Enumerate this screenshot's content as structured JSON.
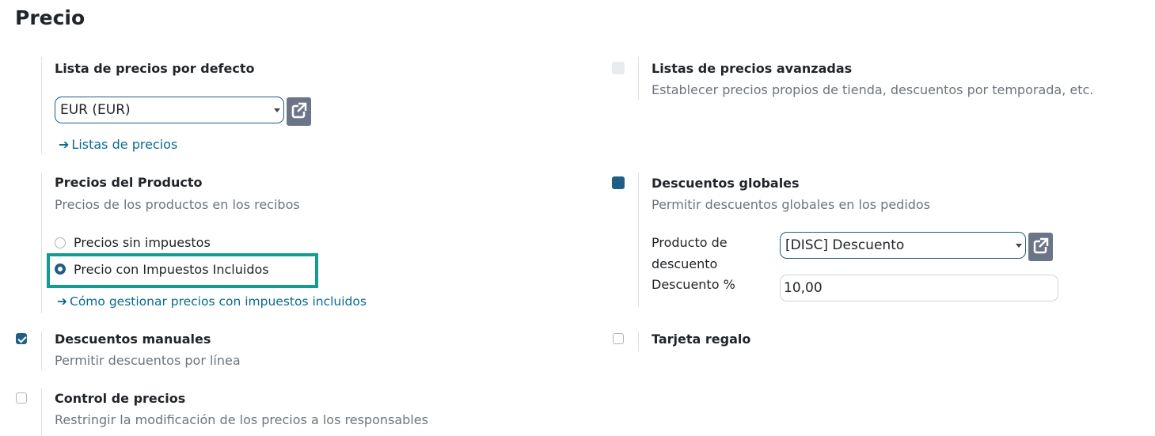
{
  "page": {
    "title": "Precio"
  },
  "default_pricelist": {
    "label": "Lista de precios por defecto",
    "value": "EUR (EUR)",
    "link": "Listas de precios"
  },
  "advanced_pricelists": {
    "label": "Listas de precios avanzadas",
    "description": "Establecer precios propios de tienda, descuentos por temporada, etc.",
    "checked": false
  },
  "product_prices": {
    "label": "Precios del Producto",
    "description": "Precios de los productos en los recibos",
    "options": [
      "Precios sin impuestos",
      "Precio con Impuestos Incluidos"
    ],
    "selected": "Precio con Impuestos Incluidos",
    "link": "Cómo gestionar precios con impuestos incluidos"
  },
  "global_discounts": {
    "label": "Descuentos globales",
    "description": "Permitir descuentos globales en los pedidos",
    "checked": true,
    "product_label_line1": "Producto de",
    "product_label_line2": "descuento",
    "product_value": "[DISC] Descuento",
    "percent_label": "Descuento %",
    "percent_value": "10,00"
  },
  "manual_discounts": {
    "label": "Descuentos manuales",
    "description": "Permitir descuentos por línea",
    "checked": true
  },
  "gift_card": {
    "label": "Tarjeta regalo",
    "checked": false
  },
  "price_control": {
    "label": "Control de precios",
    "description": "Restringir la modificación de los precios a los responsables",
    "checked": false
  },
  "colors": {
    "primary": "#1f5f86",
    "link": "#0a6b8f",
    "highlight": "#159c90"
  },
  "icons": {
    "external": "external-link-icon",
    "arrow": "arrow-right-icon"
  }
}
